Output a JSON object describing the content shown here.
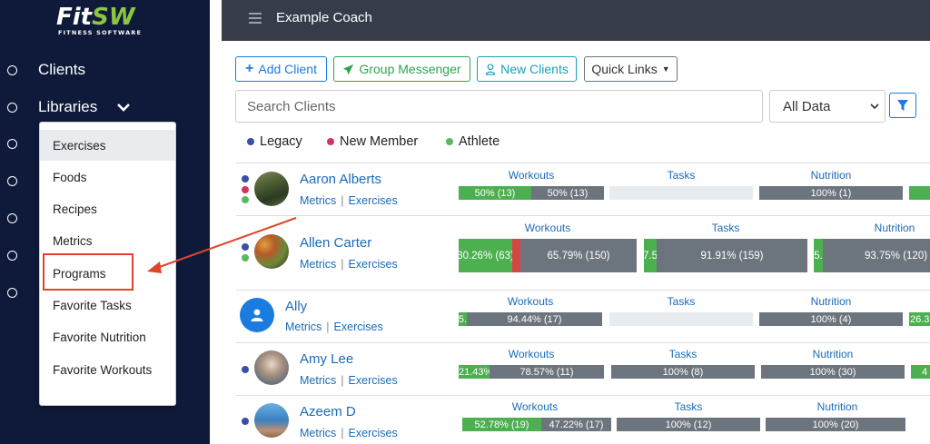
{
  "app": {
    "logo_main": "FitSW",
    "logo_sub": "FITNESS SOFTWARE"
  },
  "sidebar": {
    "clients_label": "Clients",
    "libraries_label": "Libraries",
    "dropdown": [
      "Exercises",
      "Foods",
      "Recipes",
      "Metrics",
      "Programs",
      "Favorite Tasks",
      "Favorite Nutrition",
      "Favorite Workouts"
    ]
  },
  "header": {
    "coach": "Example Coach"
  },
  "toolbar": {
    "add_client": "Add Client",
    "group_messenger": "Group Messenger",
    "new_clients": "New Clients",
    "quick_links": "Quick Links"
  },
  "search": {
    "placeholder": "Search Clients",
    "filter_value": "All Data"
  },
  "legend": [
    {
      "label": "Legacy",
      "color": "#3b4fa8"
    },
    {
      "label": "New Member",
      "color": "#d6335c"
    },
    {
      "label": "Athlete",
      "color": "#5cb85c"
    }
  ],
  "categories": {
    "workouts": "Workouts",
    "tasks": "Tasks",
    "nutrition": "Nutrition"
  },
  "links": {
    "metrics": "Metrics",
    "exercises": "Exercises"
  },
  "clients": [
    {
      "name": "Aaron Alberts",
      "workouts": [
        "50% (13)",
        "50% (13)"
      ],
      "tasks": "",
      "nutrition": "100% (1)"
    },
    {
      "name": "Allen Carter",
      "workouts": [
        "30.26% (63)",
        "65.79% (150)"
      ],
      "tasks": [
        "7.5",
        "91.91% (159)"
      ],
      "nutrition": [
        "5.",
        "93.75% (120)"
      ]
    },
    {
      "name": "Ally",
      "workouts": [
        "5.",
        "94.44% (17)"
      ],
      "tasks": "",
      "nutrition": "100% (4)",
      "extra": "26.3"
    },
    {
      "name": "Amy Lee",
      "workouts": [
        "21.43%",
        "78.57% (11)"
      ],
      "tasks": "100% (8)",
      "nutrition": "100% (30)",
      "extra": "4"
    },
    {
      "name": "Azeem D",
      "workouts": [
        "52.78% (19)",
        "47.22% (17)"
      ],
      "tasks": "100% (12)",
      "nutrition": "100% (20)"
    }
  ]
}
